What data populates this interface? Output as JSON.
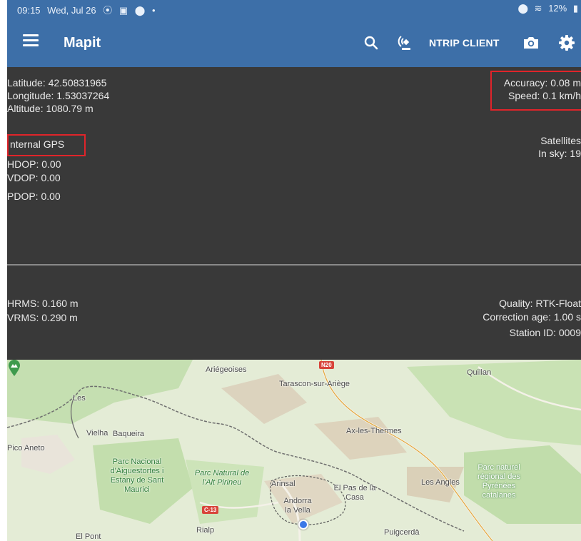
{
  "status_bar": {
    "time": "09:15",
    "date": "Wed, Jul 26",
    "battery": "12%",
    "left_icons": [
      "screen-record-icon",
      "photo-icon",
      "location-icon"
    ],
    "right_icons": [
      "location-icon",
      "wifi-icon",
      "battery-icon"
    ]
  },
  "app_bar": {
    "title": "Mapit",
    "ntrip_label": "NTRIP CLIENT",
    "icons": [
      "menu-icon",
      "search-icon",
      "gps-icon",
      "camera-icon",
      "settings-icon"
    ],
    "color": "#3d6fa8"
  },
  "gps": {
    "latitude": "Latitude: 42.50831965",
    "longitude": "Longitude: 1.53037264",
    "altitude": "Altitude: 1080.79 m",
    "accuracy": "Accuracy: 0.08 m",
    "speed": "Speed: 0.1 km/h",
    "source": "nternal GPS",
    "hdop": "HDOP: 0.00",
    "vdop": "VDOP: 0.00",
    "pdop": "PDOP: 0.00",
    "satellites": "Satellites",
    "in_sky": "In sky: 19"
  },
  "rtk": {
    "hrms": "HRMS: 0.160 m",
    "vrms": "VRMS: 0.290 m",
    "quality": "Quality: RTK-Float",
    "correction_age": "Correction age: 1.00 s",
    "station_id": "Station ID: 0009"
  },
  "map": {
    "labels": {
      "ariegeoises": "Ariégeoises",
      "tarascon": "Tarascon-sur-Ariège",
      "quillan": "Quillan",
      "les": "Les",
      "vielha": "Vielha",
      "baqueira": "Baqueira",
      "ax": "Ax-les-Thermes",
      "aneto": "Pico Aneto",
      "parc_nacional": "Parc Nacional d'Aiguestortes i Estany de Sant Maurici",
      "parc_natural": "Parc Natural de l'Alt Pirineu",
      "arinsal": "Arinsal",
      "andorra": "Andorra la Vella",
      "el_pas": "El Pas de la Casa",
      "les_angles": "Les Angles",
      "parc_naturel": "Parc naturel régional des Pyrénées catalanes",
      "rialp": "Rialp",
      "el_pont": "El Pont",
      "puigcerda": "Puigcerdà"
    },
    "road_shields": [
      "N20",
      "C-13"
    ],
    "accent": "#2f7d3a"
  }
}
